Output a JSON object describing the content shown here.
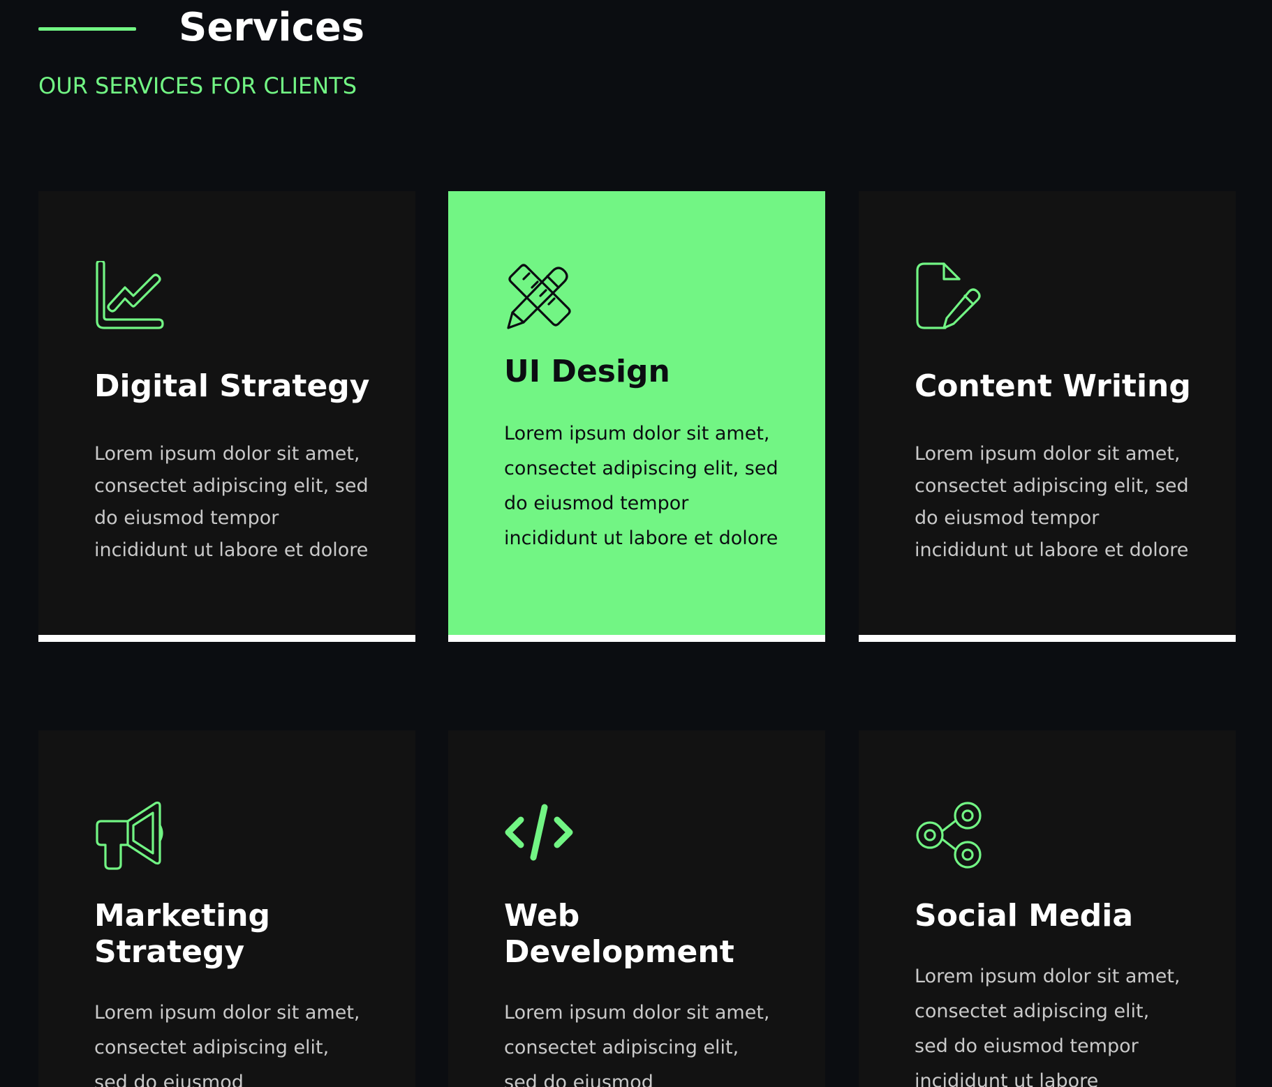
{
  "header": {
    "title": "Services",
    "subtitle": "OUR SERVICES FOR CLIENTS"
  },
  "colors": {
    "accent": "#72f584",
    "background": "#0b0d11",
    "card": "#121212"
  },
  "services": [
    {
      "icon": "chart-line-icon",
      "title": "Digital Strategy",
      "description": "Lorem ipsum dolor sit amet, consectet adipiscing elit, sed do eiusmod tempor incididunt ut labore et dolore"
    },
    {
      "icon": "pencil-ruler-icon",
      "title": "UI Design",
      "description": "Lorem ipsum dolor sit amet, consectet adipiscing elit, sed do eiusmod tempor incididunt ut labore et dolore"
    },
    {
      "icon": "document-edit-icon",
      "title": "Content Writing",
      "description": "Lorem ipsum dolor sit amet, consectet adipiscing elit, sed do eiusmod tempor incididunt ut labore et dolore"
    },
    {
      "icon": "megaphone-icon",
      "title": "Marketing Strategy",
      "description": "Lorem ipsum dolor sit amet, consectet adipiscing elit, sed do eiusmod"
    },
    {
      "icon": "code-icon",
      "title": "Web Development",
      "description": "Lorem ipsum dolor sit amet, consectet adipiscing elit, sed do eiusmod"
    },
    {
      "icon": "share-icon",
      "title": "Social Media",
      "description": "Lorem ipsum dolor sit amet, consectet adipiscing elit, sed do eiusmod tempor incididunt ut labore"
    }
  ]
}
